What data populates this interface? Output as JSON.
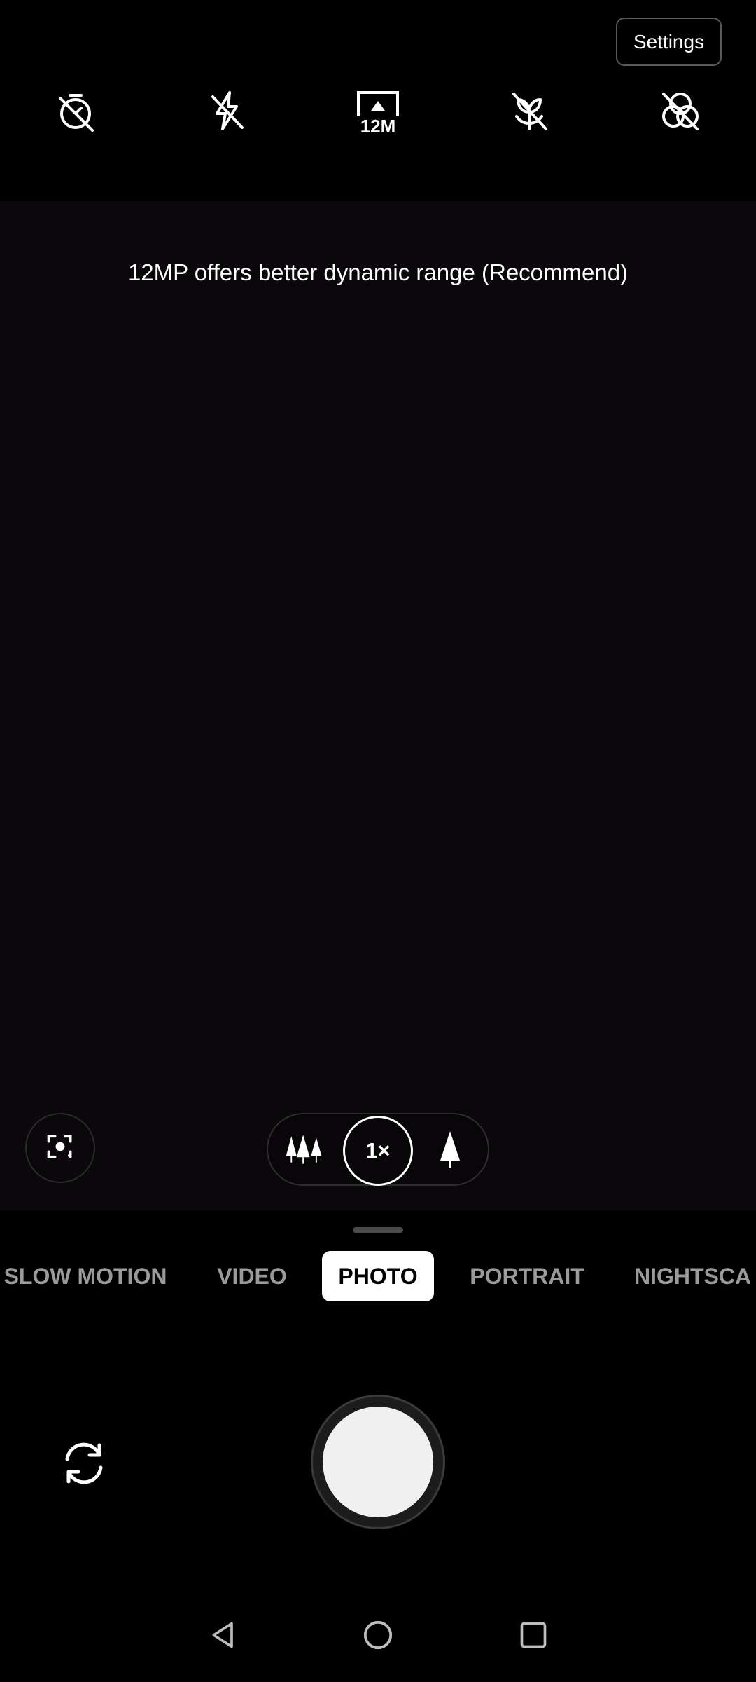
{
  "header": {
    "settings_label": "Settings",
    "icons": [
      {
        "name": "timer-off-icon"
      },
      {
        "name": "flash-off-icon"
      },
      {
        "name": "resolution-icon",
        "label": "12M"
      },
      {
        "name": "macro-off-icon"
      },
      {
        "name": "filter-off-icon"
      }
    ]
  },
  "viewfinder": {
    "hint": "12MP offers better dynamic range (Recommend)"
  },
  "zoom": {
    "current": "1×"
  },
  "modes": [
    {
      "label": "SLOW MOTION",
      "active": false
    },
    {
      "label": "VIDEO",
      "active": false
    },
    {
      "label": "PHOTO",
      "active": true
    },
    {
      "label": "PORTRAIT",
      "active": false
    },
    {
      "label": "NIGHTSCA",
      "active": false
    }
  ],
  "colors": {
    "background": "#000000",
    "viewfinder": "#0b080b",
    "active_mode_bg": "#ffffff",
    "inactive_mode_text": "#9a9a9a"
  }
}
